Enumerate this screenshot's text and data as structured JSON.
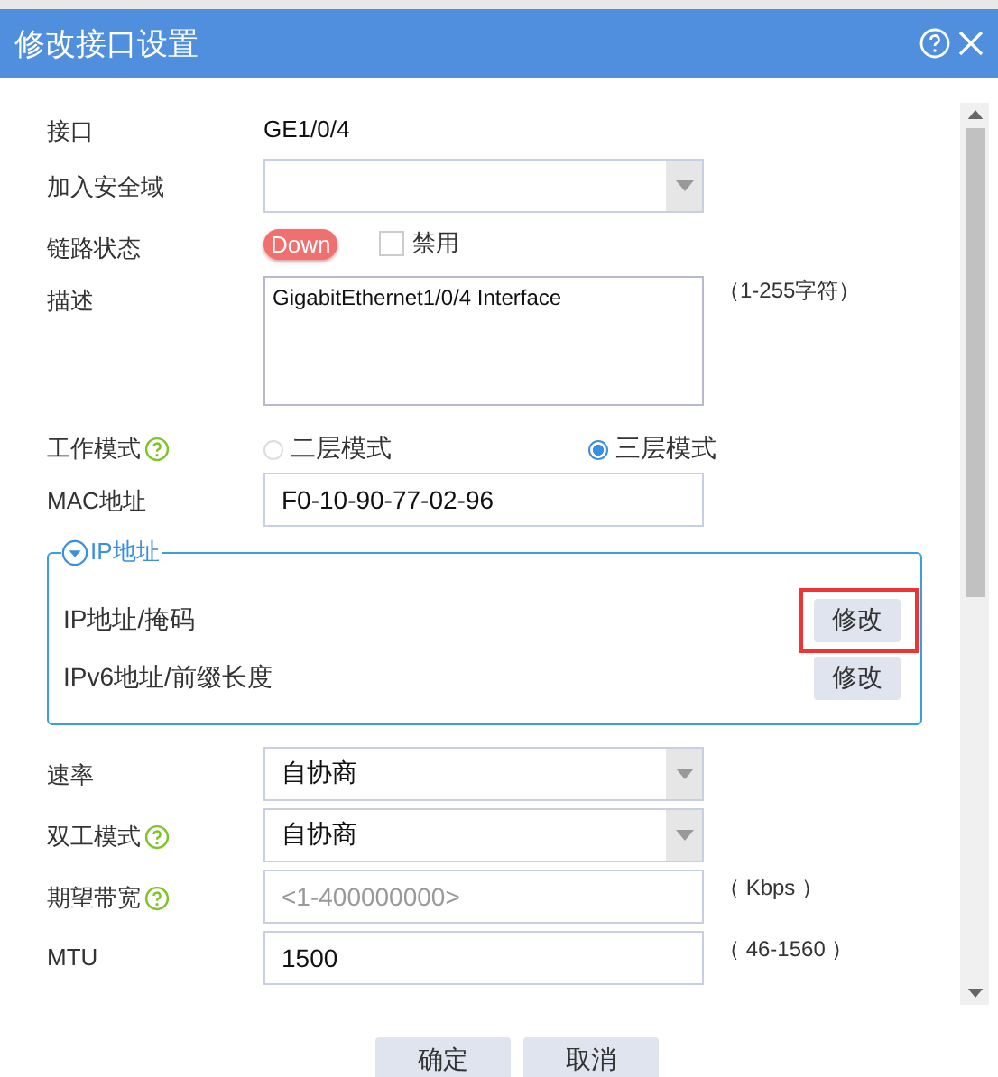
{
  "window": {
    "title": "修改接口设置"
  },
  "fields": [
    {
      "kind": "text",
      "label": "接口",
      "value": "GE1/0/4"
    },
    {
      "kind": "select",
      "label": "加入安全域"
    },
    {
      "kind": "status",
      "label": "链路状态",
      "status": "Down",
      "checkbox": {
        "label": "禁用",
        "checked": false
      }
    },
    {
      "kind": "textarea",
      "label": "描述",
      "value": "GigabitEthernet1/0/4 Interface",
      "hint": "（1-255字符）"
    },
    {
      "kind": "radio",
      "label": "工作模式",
      "help": true,
      "options": [
        {
          "label": "二层模式",
          "selected": false
        },
        {
          "label": "三层模式",
          "selected": true
        }
      ]
    },
    {
      "kind": "input",
      "label": "MAC地址",
      "value": "F0-10-90-77-02-96"
    },
    {
      "kind": "group",
      "title": "IP地址",
      "expanded": true,
      "rows": [
        {
          "label": "IP地址/掩码",
          "button": "修改",
          "highlighted": true
        },
        {
          "label": "IPv6地址/前缀长度",
          "button": "修改",
          "highlighted": false
        }
      ]
    },
    {
      "kind": "select",
      "label": "速率",
      "value": "自协商"
    },
    {
      "kind": "select",
      "label": "双工模式",
      "help": true,
      "value": "自协商"
    },
    {
      "kind": "input",
      "label": "期望带宽",
      "help": true,
      "placeholder": "<1-400000000>",
      "hint": "（ Kbps ）"
    },
    {
      "kind": "input",
      "label": "MTU",
      "value": "1500",
      "hint": "（ 46-1560 ）"
    }
  ],
  "buttons": [
    "确定",
    "取消"
  ]
}
